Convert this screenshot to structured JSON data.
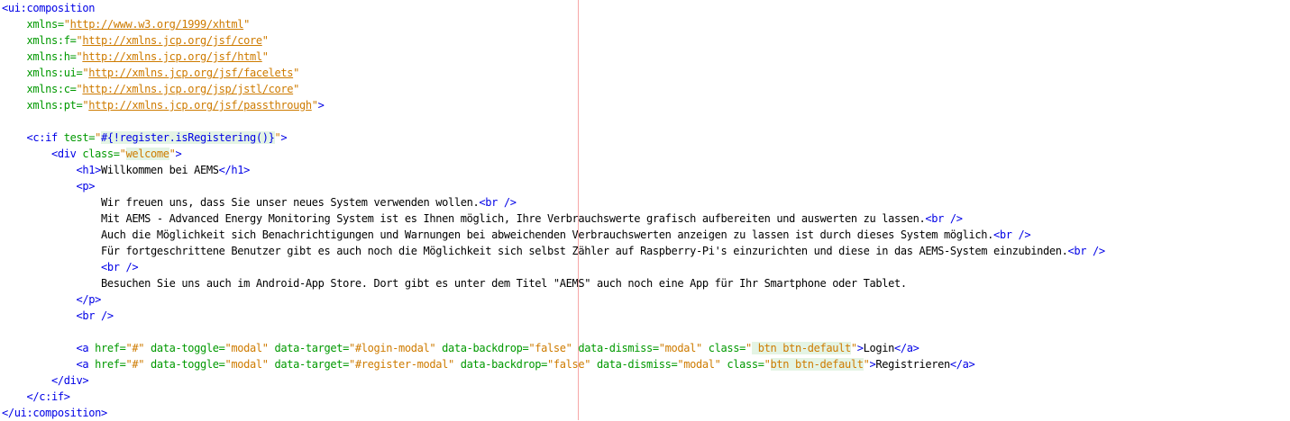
{
  "editor": {
    "language": "xhtml",
    "margin_line_color": "#f7a6a6",
    "lines": [
      {
        "indent": "",
        "parts": [
          {
            "t": "<ui:composition",
            "c": "tag"
          }
        ]
      },
      {
        "indent": "    ",
        "parts": [
          {
            "t": "xmlns=",
            "c": "attr"
          },
          {
            "t": "\"",
            "c": "val"
          },
          {
            "t": "http://www.w3.org/1999/xhtml",
            "c": "url"
          },
          {
            "t": "\"",
            "c": "val"
          }
        ]
      },
      {
        "indent": "    ",
        "parts": [
          {
            "t": "xmlns:f=",
            "c": "attr"
          },
          {
            "t": "\"",
            "c": "val"
          },
          {
            "t": "http://xmlns.jcp.org/jsf/core",
            "c": "url"
          },
          {
            "t": "\"",
            "c": "val"
          }
        ]
      },
      {
        "indent": "    ",
        "parts": [
          {
            "t": "xmlns:h=",
            "c": "attr"
          },
          {
            "t": "\"",
            "c": "val"
          },
          {
            "t": "http://xmlns.jcp.org/jsf/html",
            "c": "url"
          },
          {
            "t": "\"",
            "c": "val"
          }
        ]
      },
      {
        "indent": "    ",
        "parts": [
          {
            "t": "xmlns:ui=",
            "c": "attr"
          },
          {
            "t": "\"",
            "c": "val"
          },
          {
            "t": "http://xmlns.jcp.org/jsf/facelets",
            "c": "url"
          },
          {
            "t": "\"",
            "c": "val"
          }
        ]
      },
      {
        "indent": "    ",
        "parts": [
          {
            "t": "xmlns:c=",
            "c": "attr"
          },
          {
            "t": "\"",
            "c": "val"
          },
          {
            "t": "http://xmlns.jcp.org/jsp/jstl/core",
            "c": "url"
          },
          {
            "t": "\"",
            "c": "val"
          }
        ]
      },
      {
        "indent": "    ",
        "parts": [
          {
            "t": "xmlns:pt=",
            "c": "attr"
          },
          {
            "t": "\"",
            "c": "val"
          },
          {
            "t": "http://xmlns.jcp.org/jsf/passthrough",
            "c": "url"
          },
          {
            "t": "\"",
            "c": "val"
          },
          {
            "t": ">",
            "c": "tag"
          }
        ]
      },
      {
        "indent": "",
        "parts": []
      },
      {
        "indent": "    ",
        "parts": [
          {
            "t": "<c:if ",
            "c": "tag"
          },
          {
            "t": "test=",
            "c": "attr"
          },
          {
            "t": "\"",
            "c": "val"
          },
          {
            "t": "#{!register.isRegistering()}",
            "c": "el hl"
          },
          {
            "t": "\"",
            "c": "val"
          },
          {
            "t": ">",
            "c": "tag"
          }
        ]
      },
      {
        "indent": "        ",
        "parts": [
          {
            "t": "<div ",
            "c": "tag"
          },
          {
            "t": "class=",
            "c": "attr"
          },
          {
            "t": "\"",
            "c": "val"
          },
          {
            "t": "welcome",
            "c": "val hl"
          },
          {
            "t": "\"",
            "c": "val"
          },
          {
            "t": ">",
            "c": "tag"
          }
        ]
      },
      {
        "indent": "            ",
        "parts": [
          {
            "t": "<h1>",
            "c": "tag"
          },
          {
            "t": "Willkommen bei AEMS",
            "c": "txt"
          },
          {
            "t": "</h1>",
            "c": "tag"
          }
        ]
      },
      {
        "indent": "            ",
        "parts": [
          {
            "t": "<p>",
            "c": "tag"
          }
        ]
      },
      {
        "indent": "                ",
        "parts": [
          {
            "t": "Wir freuen uns, dass Sie unser neues System verwenden wollen.",
            "c": "txt"
          },
          {
            "t": "<br />",
            "c": "tag"
          }
        ]
      },
      {
        "indent": "                ",
        "parts": [
          {
            "t": "Mit AEMS - Advanced Energy Monitoring System ist es Ihnen möglich, Ihre Verbrauchswerte grafisch aufbereiten und auswerten zu lassen.",
            "c": "txt"
          },
          {
            "t": "<br />",
            "c": "tag"
          }
        ]
      },
      {
        "indent": "                ",
        "parts": [
          {
            "t": "Auch die Möglichkeit sich Benachrichtigungen und Warnungen bei abweichenden Verbrauchswerten anzeigen zu lassen ist durch dieses System möglich.",
            "c": "txt"
          },
          {
            "t": "<br />",
            "c": "tag"
          }
        ]
      },
      {
        "indent": "                ",
        "parts": [
          {
            "t": "Für fortgeschrittene Benutzer gibt es auch noch die Möglichkeit sich selbst Zähler auf Raspberry-Pi's einzurichten und diese in das AEMS-System einzubinden.",
            "c": "txt"
          },
          {
            "t": "<br />",
            "c": "tag"
          }
        ]
      },
      {
        "indent": "                ",
        "parts": [
          {
            "t": "<br />",
            "c": "tag"
          }
        ]
      },
      {
        "indent": "                ",
        "parts": [
          {
            "t": "Besuchen Sie uns auch im Android-App Store. Dort gibt es unter dem Titel \"AEMS\" auch noch eine App für Ihr Smartphone oder Tablet.",
            "c": "txt"
          }
        ]
      },
      {
        "indent": "            ",
        "parts": [
          {
            "t": "</p>",
            "c": "tag"
          }
        ]
      },
      {
        "indent": "            ",
        "parts": [
          {
            "t": "<br />",
            "c": "tag"
          }
        ]
      },
      {
        "indent": "",
        "parts": []
      },
      {
        "indent": "            ",
        "parts": [
          {
            "t": "<a ",
            "c": "tag"
          },
          {
            "t": "href=",
            "c": "attr"
          },
          {
            "t": "\"#\" ",
            "c": "val"
          },
          {
            "t": "data-toggle=",
            "c": "attr"
          },
          {
            "t": "\"modal\" ",
            "c": "val"
          },
          {
            "t": "data-target=",
            "c": "attr"
          },
          {
            "t": "\"#login-modal\" ",
            "c": "val"
          },
          {
            "t": "data-backdrop=",
            "c": "attr"
          },
          {
            "t": "\"false\" ",
            "c": "val"
          },
          {
            "t": "data-dismiss=",
            "c": "attr"
          },
          {
            "t": "\"modal\" ",
            "c": "val"
          },
          {
            "t": "class=",
            "c": "attr"
          },
          {
            "t": "\"",
            "c": "val"
          },
          {
            "t": " btn btn-default",
            "c": "val hl"
          },
          {
            "t": "\"",
            "c": "val"
          },
          {
            "t": ">",
            "c": "tag"
          },
          {
            "t": "Login",
            "c": "txt"
          },
          {
            "t": "</a>",
            "c": "tag"
          }
        ]
      },
      {
        "indent": "            ",
        "parts": [
          {
            "t": "<a ",
            "c": "tag"
          },
          {
            "t": "href=",
            "c": "attr"
          },
          {
            "t": "\"#\" ",
            "c": "val"
          },
          {
            "t": "data-toggle=",
            "c": "attr"
          },
          {
            "t": "\"modal\" ",
            "c": "val"
          },
          {
            "t": "data-target=",
            "c": "attr"
          },
          {
            "t": "\"#register-modal\" ",
            "c": "val"
          },
          {
            "t": "data-backdrop=",
            "c": "attr"
          },
          {
            "t": "\"false\" ",
            "c": "val"
          },
          {
            "t": "data-dismiss=",
            "c": "attr"
          },
          {
            "t": "\"modal\" ",
            "c": "val"
          },
          {
            "t": "class=",
            "c": "attr"
          },
          {
            "t": "\"",
            "c": "val"
          },
          {
            "t": "btn btn-default",
            "c": "val hl"
          },
          {
            "t": "\"",
            "c": "val"
          },
          {
            "t": ">",
            "c": "tag"
          },
          {
            "t": "Registrieren",
            "c": "txt"
          },
          {
            "t": "</a>",
            "c": "tag"
          }
        ]
      },
      {
        "indent": "        ",
        "parts": [
          {
            "t": "</div>",
            "c": "tag"
          }
        ]
      },
      {
        "indent": "    ",
        "parts": [
          {
            "t": "</c:if>",
            "c": "tag"
          }
        ]
      },
      {
        "indent": "",
        "parts": [
          {
            "t": "</ui:composition>",
            "c": "tag"
          }
        ]
      }
    ]
  }
}
